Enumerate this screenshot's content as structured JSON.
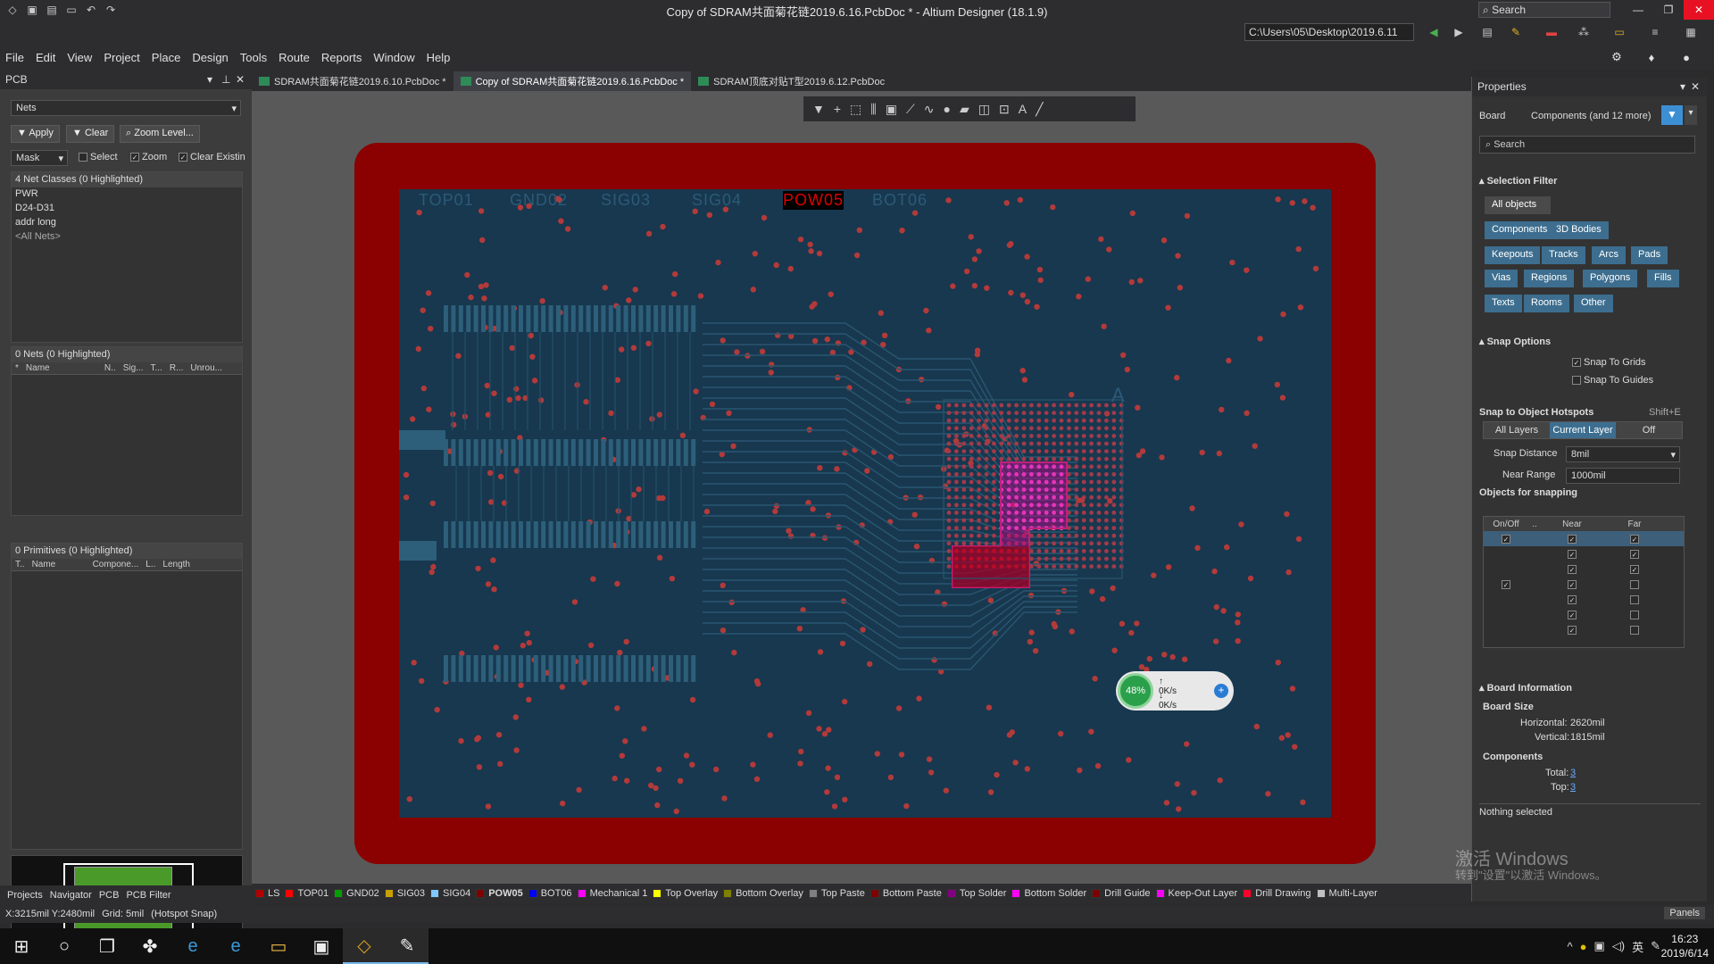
{
  "window": {
    "title": "Copy of SDRAM共面菊花链2019.6.16.PcbDoc * - Altium Designer (18.1.9)",
    "search_placeholder": "Search",
    "path": "C:\\Users\\05\\Desktop\\2019.6.11"
  },
  "menu": [
    "File",
    "Edit",
    "View",
    "Project",
    "Place",
    "Design",
    "Tools",
    "Route",
    "Reports",
    "Window",
    "Help"
  ],
  "left_panel": {
    "title": "PCB",
    "mode": "Nets",
    "apply": "Apply",
    "clear": "Clear",
    "zoom_level": "Zoom Level...",
    "mask": "Mask",
    "select": "Select",
    "zoom": "Zoom",
    "clear_existing": "Clear Existin",
    "net_classes_header": "4 Net Classes (0 Highlighted)",
    "net_classes": [
      "PWR",
      "D24-D31",
      "addr long",
      "<All Nets>"
    ],
    "nets_header": "0 Nets (0 Highlighted)",
    "nets_cols": [
      "*",
      "Name",
      "N..",
      "Sig...",
      "T...",
      "R...",
      "Unrou..."
    ],
    "prims_header": "0 Primitives (0 Highlighted)",
    "prims_cols": [
      "T..",
      "Name",
      "Compone...",
      "L..",
      "Length"
    ],
    "bottom_tabs": [
      "Projects",
      "Navigator",
      "PCB",
      "PCB Filter"
    ]
  },
  "doc_tabs": [
    {
      "label": "SDRAM共面菊花链2019.6.10.PcbDoc *",
      "active": false
    },
    {
      "label": "Copy of SDRAM共面菊花链2019.6.16.PcbDoc *",
      "active": true
    },
    {
      "label": "SDRAM顶底对贴T型2019.6.12.PcbDoc",
      "active": false
    }
  ],
  "board": {
    "layer_labels": [
      "TOP01",
      "GND02",
      "SIG03",
      "SIG04",
      "POW05",
      "BOT06"
    ],
    "corner_mark": "A",
    "gauge_pct": "48%",
    "net_up": "0K/s",
    "net_down": "0K/s"
  },
  "properties": {
    "title": "Properties",
    "scope": "Board",
    "filter_label": "Components (and 12 more)",
    "search_placeholder": "Search",
    "selection_filter": "Selection Filter",
    "all_objects": "All objects",
    "filters": [
      "Components",
      "3D Bodies",
      "Keepouts",
      "Tracks",
      "Arcs",
      "Pads",
      "Vias",
      "Regions",
      "Polygons",
      "Fills",
      "Texts",
      "Rooms",
      "Other"
    ],
    "snap_options": "Snap Options",
    "snap_grids": "Snap To Grids",
    "snap_guides": "Snap To Guides",
    "hotspots": "Snap to Object Hotspots",
    "hotspots_key": "Shift+E",
    "seg": [
      "All Layers",
      "Current Layer",
      "Off"
    ],
    "snap_distance_label": "Snap Distance",
    "snap_distance": "8mil",
    "near_range_label": "Near Range",
    "near_range": "1000mil",
    "objects_for_snapping": "Objects for snapping",
    "snap_cols": [
      "On/Off",
      "..",
      "Near",
      "Far"
    ],
    "board_info": "Board Information",
    "board_size": "Board Size",
    "horizontal_label": "Horizontal:",
    "horizontal": "2620mil",
    "vertical_label": "Vertical:",
    "vertical": "1815mil",
    "components": "Components",
    "total_label": "Total:",
    "total": "3",
    "top_label": "Top:",
    "top": "3",
    "nothing_selected": "Nothing selected"
  },
  "layers": [
    {
      "name": "LS",
      "color": "#b00000"
    },
    {
      "name": "TOP01",
      "color": "#ff0000"
    },
    {
      "name": "GND02",
      "color": "#00a000"
    },
    {
      "name": "SIG03",
      "color": "#c8a000"
    },
    {
      "name": "SIG04",
      "color": "#7ec8ff"
    },
    {
      "name": "POW05",
      "color": "#800000"
    },
    {
      "name": "BOT06",
      "color": "#0000ff"
    },
    {
      "name": "Mechanical 1",
      "color": "#ff00ff"
    },
    {
      "name": "Top Overlay",
      "color": "#ffff00"
    },
    {
      "name": "Bottom Overlay",
      "color": "#808000"
    },
    {
      "name": "Top Paste",
      "color": "#808080"
    },
    {
      "name": "Bottom Paste",
      "color": "#800000"
    },
    {
      "name": "Top Solder",
      "color": "#800080"
    },
    {
      "name": "Bottom Solder",
      "color": "#ff00ff"
    },
    {
      "name": "Drill Guide",
      "color": "#800000"
    },
    {
      "name": "Keep-Out Layer",
      "color": "#ff00ff"
    },
    {
      "name": "Drill Drawing",
      "color": "#ff002a"
    },
    {
      "name": "Multi-Layer",
      "color": "#c0c0c0"
    }
  ],
  "status": {
    "coords": "X:3215mil Y:2480mil",
    "grid": "Grid: 5mil",
    "snap": "(Hotspot Snap)",
    "panels": "Panels"
  },
  "watermark": {
    "line1": "激活 Windows",
    "line2": "转到\"设置\"以激活 Windows。"
  },
  "clock": {
    "time": "16:23",
    "date": "2019/6/14"
  },
  "tray": {
    "ime": "英"
  }
}
